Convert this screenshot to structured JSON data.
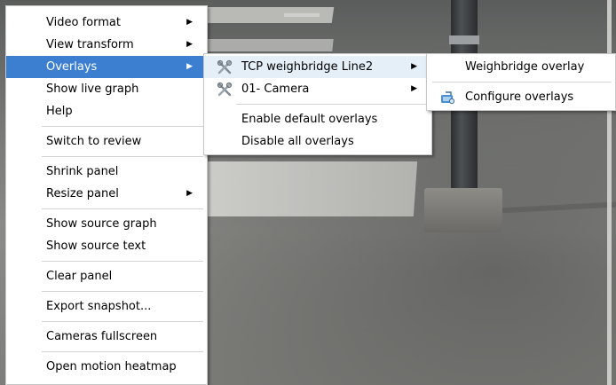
{
  "main_menu": {
    "items": [
      {
        "label": "Video format",
        "has_submenu": true
      },
      {
        "label": "View transform",
        "has_submenu": true
      },
      {
        "label": "Overlays",
        "has_submenu": true,
        "highlighted": true
      },
      {
        "label": "Show live graph"
      },
      {
        "label": "Help"
      },
      {
        "label": "Switch to review"
      },
      {
        "label": "Shrink panel"
      },
      {
        "label": "Resize panel",
        "has_submenu": true
      },
      {
        "label": "Show source graph"
      },
      {
        "label": "Show source text"
      },
      {
        "label": "Clear panel"
      },
      {
        "label": "Export snapshot..."
      },
      {
        "label": "Cameras fullscreen"
      },
      {
        "label": "Open motion heatmap"
      }
    ]
  },
  "overlays_submenu": {
    "items": [
      {
        "label": "TCP weighbridge Line2",
        "icon": "tools-icon",
        "has_submenu": true,
        "highlighted": true
      },
      {
        "label": "01- Camera",
        "icon": "tools-icon",
        "has_submenu": true
      },
      {
        "label": "Enable default overlays"
      },
      {
        "label": "Disable all overlays"
      }
    ]
  },
  "weighbridge_submenu": {
    "items": [
      {
        "label": "Weighbridge overlay"
      },
      {
        "label": "Configure overlays",
        "icon": "configure-overlays-icon"
      }
    ]
  },
  "colors": {
    "highlight": "#3c7fd0",
    "menu_background": "#ffffff",
    "separator": "#d4d4d4"
  }
}
